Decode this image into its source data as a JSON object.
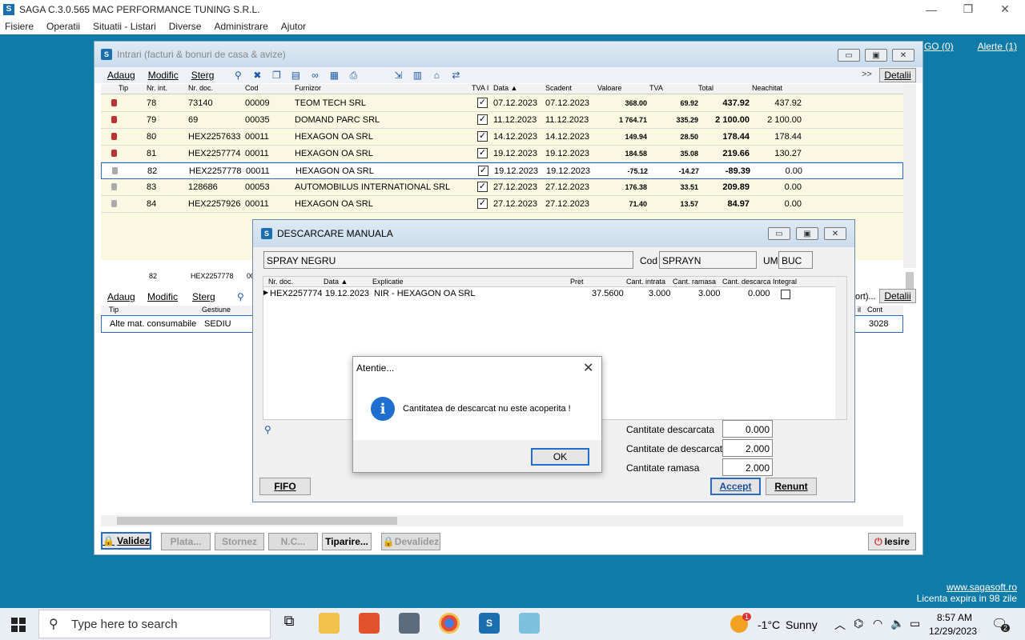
{
  "window": {
    "title": "SAGA C.3.0.565  MAC PERFORMANCE TUNING S.R.L."
  },
  "menu": [
    "Fisiere",
    "Operatii",
    "Situatii - Listari",
    "Diverse",
    "Administrare",
    "Ajutor"
  ],
  "toplinks": {
    "go": "GO (0)",
    "alerte": "Alerte (1)"
  },
  "footer": {
    "site": "www.sagasoft.ro",
    "licenta": "Licenta expira in 98 zile"
  },
  "intrari": {
    "title": "Intrari (facturi & bonuri de casa & avize)",
    "toolbar": {
      "adaug": "Adaug",
      "modific": "Modific",
      "sterg": "Sterg",
      "more": ">>",
      "detalii": "Detalii"
    },
    "columns": [
      "Tip",
      "Nr. int.",
      "Nr. doc.",
      "Cod",
      "Furnizor",
      "TVA I",
      "Data ▲",
      "Scadent",
      "Valoare",
      "TVA",
      "Total",
      "Neachitat"
    ],
    "rows": [
      {
        "locked": "red",
        "nr": "78",
        "doc": "73140",
        "cod": "00009",
        "furnizor": "TEOM TECH SRL",
        "data": "07.12.2023",
        "scadent": "07.12.2023",
        "valoare": "368.00",
        "tva": "69.92",
        "total": "437.92",
        "neachitat": "437.92"
      },
      {
        "locked": "red",
        "nr": "79",
        "doc": "69",
        "cod": "00035",
        "furnizor": "DOMAND PARC SRL",
        "data": "11.12.2023",
        "scadent": "11.12.2023",
        "valoare": "1 764.71",
        "tva": "335.29",
        "total": "2 100.00",
        "neachitat": "2 100.00"
      },
      {
        "locked": "red",
        "nr": "80",
        "doc": "HEX2257633",
        "cod": "00011",
        "furnizor": "HEXAGON OA SRL",
        "data": "14.12.2023",
        "scadent": "14.12.2023",
        "valoare": "149.94",
        "tva": "28.50",
        "total": "178.44",
        "neachitat": "178.44"
      },
      {
        "locked": "red",
        "nr": "81",
        "doc": "HEX2257774",
        "cod": "00011",
        "furnizor": "HEXAGON OA SRL",
        "data": "19.12.2023",
        "scadent": "19.12.2023",
        "valoare": "184.58",
        "tva": "35.08",
        "total": "219.66",
        "neachitat": "130.27"
      },
      {
        "locked": "gray",
        "nr": "82",
        "doc": "HEX2257778",
        "cod": "00011",
        "furnizor": "HEXAGON OA SRL",
        "data": "19.12.2023",
        "scadent": "19.12.2023",
        "valoare": "-75.12",
        "tva": "-14.27",
        "total": "-89.39",
        "neachitat": "0.00"
      },
      {
        "locked": "gray",
        "nr": "83",
        "doc": "128686",
        "cod": "00053",
        "furnizor": "AUTOMOBILUS INTERNATIONAL SRL",
        "data": "27.12.2023",
        "scadent": "27.12.2023",
        "valoare": "176.38",
        "tva": "33.51",
        "total": "209.89",
        "neachitat": "0.00"
      },
      {
        "locked": "gray",
        "nr": "84",
        "doc": "HEX2257926",
        "cod": "00011",
        "furnizor": "HEXAGON OA SRL",
        "data": "27.12.2023",
        "scadent": "27.12.2023",
        "valoare": "71.40",
        "tva": "13.57",
        "total": "84.97",
        "neachitat": "0.00"
      }
    ],
    "summary": {
      "nr": "82",
      "doc": "HEX2257778",
      "cod": "00"
    },
    "lines": {
      "adaug": "Adaug",
      "modific": "Modific",
      "sterg": "Sterg",
      "more": "ort)...",
      "detalii": "Detalii",
      "col_tip": "Tip",
      "col_gestiune": "Gestiune",
      "col_il": "il",
      "col_cont": "Cont",
      "tip": "Alte mat. consumabile",
      "gestiune": "SEDIU",
      "cont": "3028"
    },
    "bottom": {
      "validez": "Validez",
      "plata": "Plata...",
      "stornez": "Stornez",
      "nc": "N.C...",
      "tiparire": "Tiparire...",
      "devalidez": "Devalidez",
      "iesire": "Iesire"
    }
  },
  "descarcare": {
    "title": "DESCARCARE MANUALA",
    "produs": "SPRAY NEGRU",
    "cod_label": "Cod",
    "cod": "SPRAYN",
    "um_label": "UM",
    "um": "BUC",
    "columns": [
      "Nr. doc.",
      "Data ▲",
      "Explicatie",
      "Pret",
      "Cant. intrata",
      "Cant. ramasa",
      "Cant. descarca",
      "Integral"
    ],
    "row": {
      "doc": "HEX2257774",
      "data": "19.12.2023",
      "explicatie": "NIR - HEXAGON OA SRL",
      "pret": "37.5600",
      "intrata": "3.000",
      "ramasa": "3.000",
      "descarca": "0.000"
    },
    "cant_descarcata_label": "Cantitate descarcata",
    "cant_descarcata": "0.000",
    "cant_de_descarcat_label": "Cantitate de descarcat",
    "cant_de_descarcat": "2.000",
    "cant_ramasa_label": "Cantitate ramasa",
    "cant_ramasa": "2.000",
    "fifo": "FIFO",
    "accept": "Accept",
    "renunt": "Renunt"
  },
  "alert": {
    "title": "Atentie...",
    "message": "Cantitatea de descarcat nu este acoperita !",
    "ok": "OK"
  },
  "taskbar": {
    "search": "Type here to search",
    "weather_temp": "-1°C",
    "weather_desc": "Sunny",
    "time": "8:57 AM",
    "date": "12/29/2023",
    "notif": "2",
    "weather_badge": "1"
  }
}
